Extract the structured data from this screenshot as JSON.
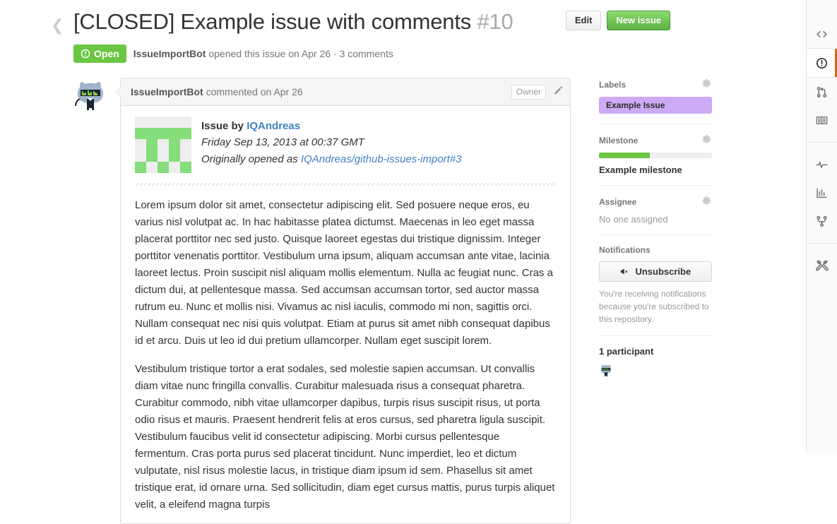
{
  "header": {
    "back_icon": "chevron-left-icon",
    "title": "[CLOSED] Example issue with comments",
    "number": "#10",
    "state": "Open",
    "state_icon": "issue-opened-icon",
    "state_color": "#6cc644",
    "author": "IssueImportBot",
    "meta_text": "opened this issue on Apr 26 · 3 comments",
    "edit_label": "Edit",
    "new_issue_label": "New issue"
  },
  "comment": {
    "avatar_icon": "octocat-avatar",
    "author": "IssueImportBot",
    "action_text": "commented on Apr 26",
    "owner_badge": "Owner",
    "edit_icon": "pencil-icon",
    "identicon_icon": "identicon",
    "issue_by_prefix": "Issue by ",
    "issue_by_user": "IQAndreas",
    "date_line": "Friday Sep 13, 2013 at 00:37 GMT",
    "origin_prefix": "Originally opened as ",
    "origin_link": "IQAndreas/github-issues-import#3",
    "paragraphs": [
      "Lorem ipsum dolor sit amet, consectetur adipiscing elit. Sed posuere neque eros, eu varius nisl volutpat ac. In hac habitasse platea dictumst. Maecenas in leo eget massa placerat porttitor nec sed justo. Quisque laoreet egestas dui tristique dignissim. Integer porttitor venenatis porttitor. Vestibulum urna ipsum, aliquam accumsan ante vitae, lacinia laoreet lectus. Proin suscipit nisl aliquam mollis elementum. Nulla ac feugiat nunc. Cras a dictum dui, at pellentesque massa. Sed accumsan accumsan tortor, sed auctor massa rutrum eu. Nunc et mollis nisi. Vivamus ac nisl iaculis, commodo mi non, sagittis orci. Nullam consequat nec nisi quis volutpat. Etiam at purus sit amet nibh consequat dapibus id et arcu. Duis ut leo id dui pretium ullamcorper. Nullam eget suscipit lorem.",
      "Vestibulum tristique tortor a erat sodales, sed molestie sapien accumsan. Ut convallis diam vitae nunc fringilla convallis. Curabitur malesuada risus a consequat pharetra. Curabitur commodo, nibh vitae ullamcorper dapibus, turpis risus suscipit risus, ut porta odio risus et mauris. Praesent hendrerit felis at eros cursus, sed pharetra ligula suscipit. Vestibulum faucibus velit id consectetur adipiscing. Morbi cursus pellentesque fermentum. Cras porta purus sed placerat tincidunt. Nunc imperdiet, leo et dictum vulputate, nisl risus molestie lacus, in tristique diam ipsum id sem. Phasellus sit amet tristique erat, id ornare urna. Sed sollicitudin, diam eget cursus mattis, purus turpis aliquet velit, a eleifend magna turpis"
    ],
    "identicon_color": "#85de7b",
    "identicon_bg": "#eeeeee",
    "identicon_grid": [
      0,
      0,
      0,
      0,
      0,
      1,
      1,
      1,
      1,
      1,
      0,
      1,
      0,
      1,
      0,
      0,
      1,
      0,
      1,
      0,
      1,
      0,
      1,
      0,
      1
    ]
  },
  "sidebar": {
    "labels": {
      "title": "Labels",
      "gear_icon": "gear-icon",
      "items": [
        {
          "name": "Example Issue",
          "color": "#cdaaf5"
        }
      ]
    },
    "milestone": {
      "title": "Milestone",
      "gear_icon": "gear-icon",
      "progress_percent": 45,
      "progress_color": "#6cc644",
      "name": "Example milestone"
    },
    "assignee": {
      "title": "Assignee",
      "gear_icon": "gear-icon",
      "value": "No one assigned"
    },
    "notifications": {
      "title": "Notifications",
      "button_label": "Unsubscribe",
      "button_icon": "mute-icon",
      "note": "You're receiving notifications because you're subscribed to this repository."
    },
    "participants": {
      "title": "1 participant",
      "avatar_icon": "octocat-avatar"
    }
  },
  "rail": {
    "items": [
      {
        "icon": "code-icon",
        "name": "code",
        "active": false
      },
      {
        "icon": "issue-icon",
        "name": "issues",
        "active": true
      },
      {
        "icon": "pull-request-icon",
        "name": "pull-requests",
        "active": false
      },
      {
        "icon": "book-icon",
        "name": "wiki",
        "active": false
      },
      {
        "icon": "pulse-icon",
        "name": "pulse",
        "active": false
      },
      {
        "icon": "graph-icon",
        "name": "graphs",
        "active": false
      },
      {
        "icon": "network-icon",
        "name": "network",
        "active": false
      },
      {
        "icon": "tools-icon",
        "name": "settings",
        "active": false
      }
    ],
    "active_indicator_color": "#d26911"
  }
}
